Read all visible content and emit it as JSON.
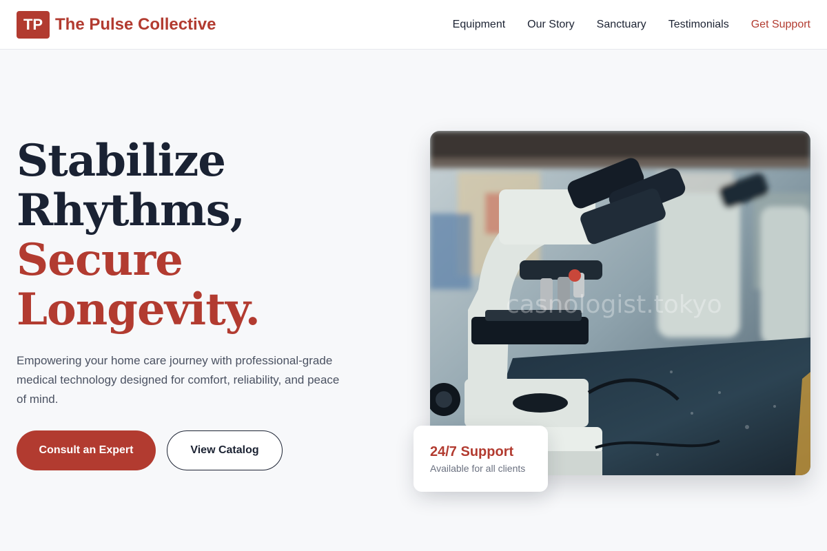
{
  "header": {
    "logo_initials": "TP",
    "brand_name": "The Pulse Collective",
    "nav": [
      {
        "label": "Equipment"
      },
      {
        "label": "Our Story"
      },
      {
        "label": "Sanctuary"
      },
      {
        "label": "Testimonials"
      },
      {
        "label": "Get Support"
      }
    ]
  },
  "hero": {
    "headline_line1": "Stabilize",
    "headline_line2": "Rhythms,",
    "headline_line3": "Secure",
    "headline_line4": "Longevity.",
    "description": "Empowering your home care journey with professional-grade medical technology designed for comfort, reliability, and peace of mind.",
    "primary_button": "Consult an Expert",
    "secondary_button": "View Catalog"
  },
  "image": {
    "watermark": "casnologist.tokyo"
  },
  "support_card": {
    "title": "24/7 Support",
    "subtitle": "Available for all clients"
  },
  "colors": {
    "accent": "#b23b30",
    "text_dark": "#1a2233",
    "background": "#f7f8fa"
  }
}
